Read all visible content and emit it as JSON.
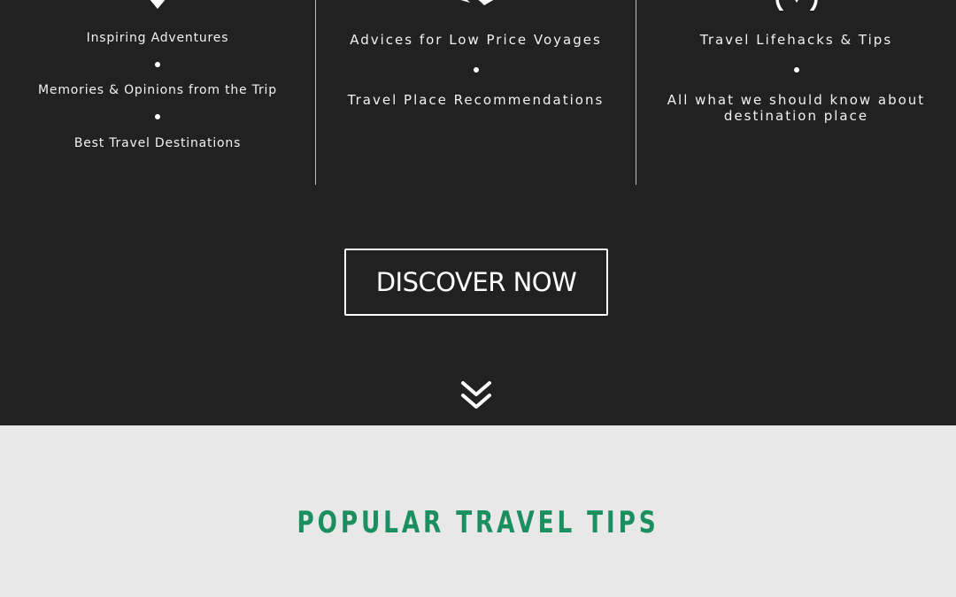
{
  "features": {
    "col1": {
      "icon": "map-pin-icon",
      "items": [
        "Inspiring Adventures",
        "Memories & Opinions from the Trip",
        "Best Travel Destinations"
      ]
    },
    "col2": {
      "icon": "plane-icon",
      "items": [
        "Advices for Low Price Voyages",
        "Travel Place Recommendations"
      ]
    },
    "col3": {
      "icon": "compass-icon",
      "items": [
        "Travel Lifehacks & Tips",
        "All what we should know about destination place"
      ]
    }
  },
  "cta": {
    "label": "DISCOVER NOW"
  },
  "scroll_icon": "double-chevron-down-icon",
  "popular": {
    "title": "POPULAR TRAVEL TIPS"
  },
  "colors": {
    "dark_bg": "#222122",
    "light_bg": "#e8e8e8",
    "accent": "#1b8f5f"
  }
}
